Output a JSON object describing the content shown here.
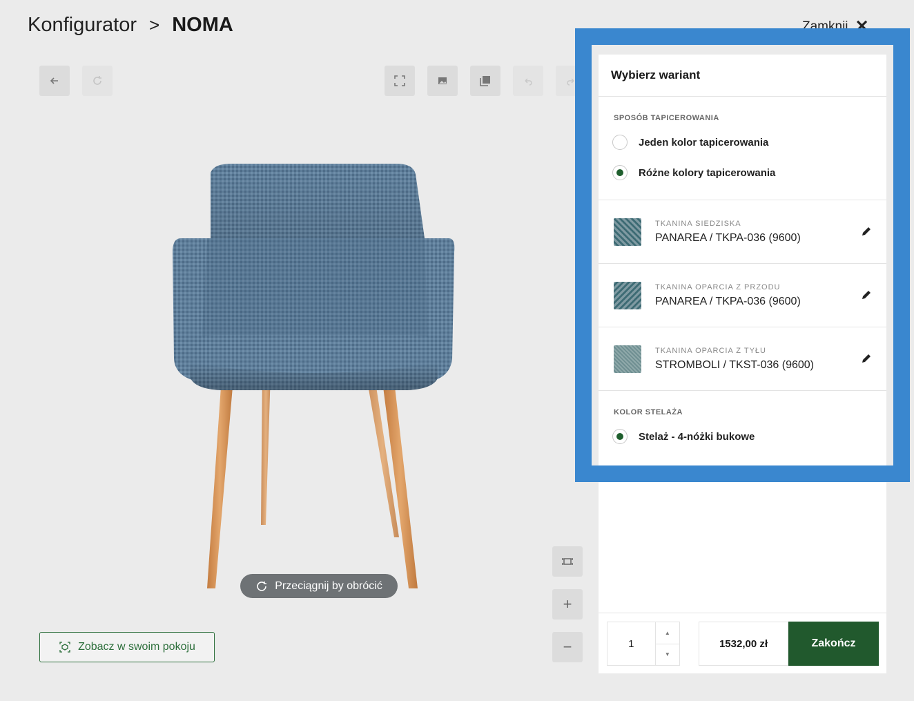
{
  "header": {
    "breadcrumb_root": "Konfigurator",
    "separator": ">",
    "product": "NOMA",
    "close_label": "Zamknij",
    "close_glyph": "✕"
  },
  "toolbar": {
    "icons": [
      "back-arrow-icon",
      "reset-icon",
      "fullscreen-icon",
      "image-icon",
      "pdf-icon",
      "undo-icon",
      "redo-icon"
    ]
  },
  "viewer": {
    "rotate_hint": "Przeciągnij by obrócić",
    "room_button": "Zobacz w swoim pokoju",
    "zoom_in": "+",
    "zoom_out": "−"
  },
  "panel": {
    "title": "Wybierz wariant",
    "upholstery": {
      "label": "SPOSÓB TAPICEROWANIA",
      "options": [
        {
          "label": "Jeden kolor tapicerowania",
          "selected": false
        },
        {
          "label": "Różne kolory tapicerowania",
          "selected": true
        }
      ]
    },
    "fabrics": [
      {
        "label": "TKANINA SIEDZISKA",
        "value": "PANAREA / TKPA-036 (9600)"
      },
      {
        "label": "TKANINA OPARCIA Z PRZODU",
        "value": "PANAREA / TKPA-036 (9600)"
      },
      {
        "label": "TKANINA OPARCIA Z TYŁU",
        "value": "STROMBOLI / TKST-036 (9600)"
      }
    ],
    "frame": {
      "label": "KOLOR STELAŻA",
      "option": "Stelaż - 4-nóżki bukowe",
      "selected": true
    }
  },
  "footer": {
    "quantity": "1",
    "price": "1532,00 zł",
    "finish_button": "Zakończ"
  },
  "colors": {
    "accent_green": "#21592d",
    "highlight_blue": "#3a87cf",
    "fabric_blue": "#5f7f9b",
    "wood": "#d9955a"
  }
}
